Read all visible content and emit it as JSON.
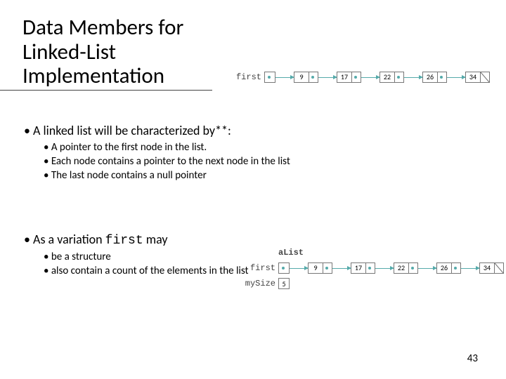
{
  "title_line1": "Data Members for Linked-List",
  "title_line2": "Implementation",
  "bullet1": "• A linked list will be characterized by**:",
  "sub1": {
    "a": "• A pointer to the first node in the list.",
    "b": "• Each node contains a pointer to the next node in the list",
    "c": "• The last node contains a null pointer"
  },
  "bullet2_pre": "• As a variation ",
  "bullet2_code": "first",
  "bullet2_post": " may",
  "sub2": {
    "a": "• be a structure",
    "b": "• also contain a count of the elements in the list"
  },
  "page": "43",
  "diagram1": {
    "label": "first",
    "values": [
      "9",
      "17",
      "22",
      "26",
      "34"
    ]
  },
  "diagram2": {
    "header": "aList",
    "label1": "first",
    "label2": "mySize",
    "size": "5",
    "values": [
      "9",
      "17",
      "22",
      "26",
      "34"
    ]
  }
}
